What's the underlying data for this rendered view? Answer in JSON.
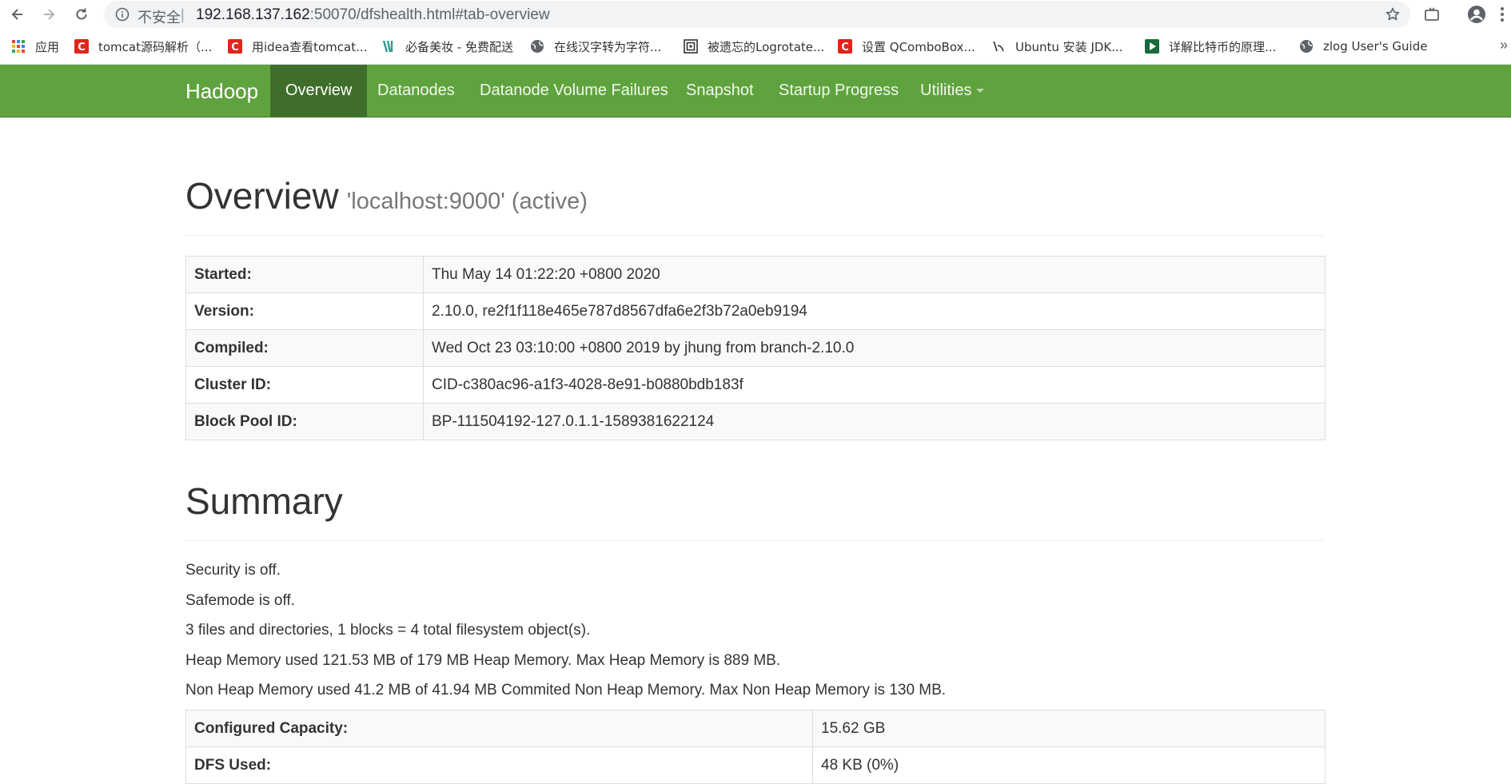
{
  "browser": {
    "insecure_label": "不安全",
    "separator": "|",
    "url_host": "192.168.137.162",
    "url_path": ":50070/dfshealth.html#tab-overview",
    "bookmarks": [
      {
        "label": "应用",
        "icon": "apps-grid-icon"
      },
      {
        "label": "tomcat源码解析（...",
        "icon": "csdn-icon"
      },
      {
        "label": "用idea查看tomcat...",
        "icon": "csdn-icon"
      },
      {
        "label": "必备美妆 - 免费配送",
        "icon": "bookmark-site-icon"
      },
      {
        "label": "在线汉字转为字符...",
        "icon": "globe-icon"
      },
      {
        "label": "被遗忘的Logrotate...",
        "icon": "site-icon"
      },
      {
        "label": "设置 QComboBox...",
        "icon": "csdn-icon"
      },
      {
        "label": "Ubuntu 安装 JDK...",
        "icon": "site-icon"
      },
      {
        "label": "详解比特币的原理...",
        "icon": "play-icon"
      },
      {
        "label": "zlog User's Guide",
        "icon": "globe-icon"
      }
    ],
    "more": "»"
  },
  "navbar": {
    "brand": "Hadoop",
    "items": [
      {
        "label": "Overview",
        "active": true
      },
      {
        "label": "Datanodes"
      },
      {
        "label": "Datanode Volume Failures"
      },
      {
        "label": "Snapshot"
      },
      {
        "label": "Startup Progress"
      },
      {
        "label": "Utilities",
        "has_dropdown": true
      }
    ],
    "color": "#5fa33e",
    "active_color": "#3e6e2a"
  },
  "overview": {
    "title": "Overview",
    "subtitle": "'localhost:9000' (active)",
    "rows": [
      {
        "key": "Started:",
        "value": "Thu May 14 01:22:20 +0800 2020"
      },
      {
        "key": "Version:",
        "value": "2.10.0, re2f1f118e465e787d8567dfa6e2f3b72a0eb9194"
      },
      {
        "key": "Compiled:",
        "value": "Wed Oct 23 03:10:00 +0800 2019 by jhung from branch-2.10.0"
      },
      {
        "key": "Cluster ID:",
        "value": "CID-c380ac96-a1f3-4028-8e91-b0880bdb183f"
      },
      {
        "key": "Block Pool ID:",
        "value": "BP-111504192-127.0.1.1-1589381622124"
      }
    ]
  },
  "summary": {
    "title": "Summary",
    "lines": [
      "Security is off.",
      "Safemode is off.",
      "3 files and directories, 1 blocks = 4 total filesystem object(s).",
      "Heap Memory used 121.53 MB of 179 MB Heap Memory. Max Heap Memory is 889 MB.",
      "Non Heap Memory used 41.2 MB of 41.94 MB Commited Non Heap Memory. Max Non Heap Memory is 130 MB."
    ],
    "rows": [
      {
        "key": "Configured Capacity:",
        "value": "15.62 GB"
      },
      {
        "key": "DFS Used:",
        "value": "48 KB (0%)"
      }
    ]
  }
}
